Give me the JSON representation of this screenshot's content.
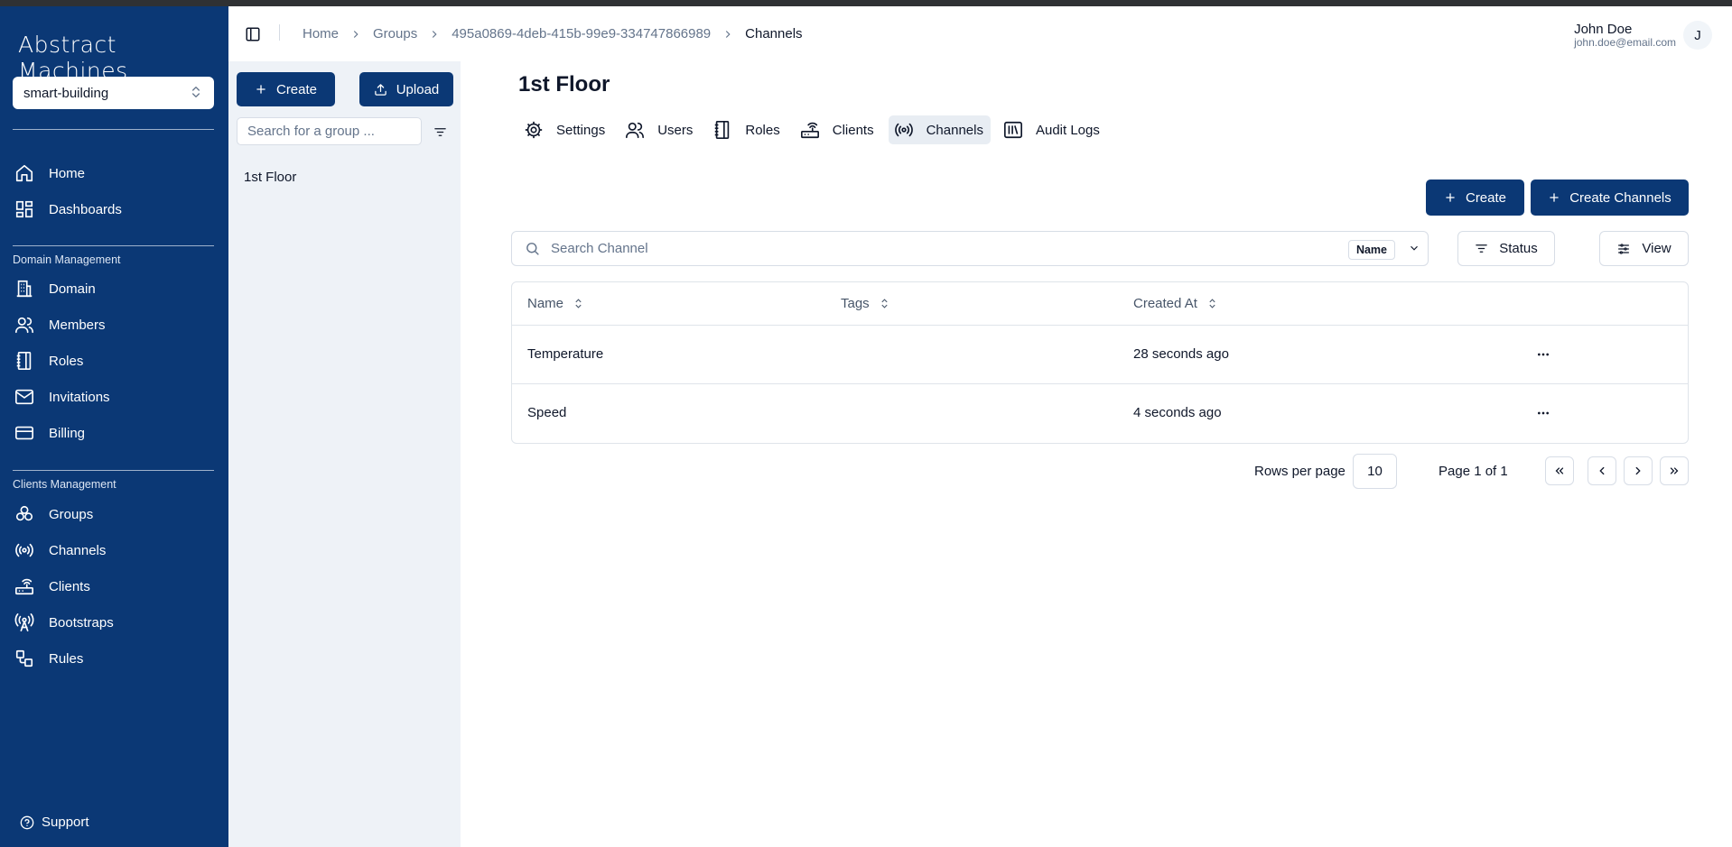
{
  "app": {
    "brand": "Abstract Machines"
  },
  "workspace": {
    "selected": "smart-building"
  },
  "sidebar": {
    "main_items": [
      {
        "label": "Home",
        "icon": "home-icon"
      },
      {
        "label": "Dashboards",
        "icon": "dashboard-icon"
      }
    ],
    "domain_section": "Domain Management",
    "domain_items": [
      {
        "label": "Domain",
        "icon": "building-icon"
      },
      {
        "label": "Members",
        "icon": "users-icon"
      },
      {
        "label": "Roles",
        "icon": "notebook-icon"
      },
      {
        "label": "Invitations",
        "icon": "mail-icon"
      },
      {
        "label": "Billing",
        "icon": "credit-card-icon"
      }
    ],
    "clients_section": "Clients Management",
    "clients_items": [
      {
        "label": "Groups",
        "icon": "groups-icon"
      },
      {
        "label": "Channels",
        "icon": "radio-icon"
      },
      {
        "label": "Clients",
        "icon": "router-icon"
      },
      {
        "label": "Bootstraps",
        "icon": "antenna-icon"
      },
      {
        "label": "Rules",
        "icon": "workflow-icon"
      }
    ],
    "support": "Support"
  },
  "header": {
    "breadcrumb": [
      "Home",
      "Groups",
      "495a0869-4deb-415b-99e9-334747866989",
      "Channels"
    ],
    "user": {
      "name": "John Doe",
      "email": "john.doe@email.com",
      "initial": "J"
    }
  },
  "groups_panel": {
    "create_label": "Create",
    "upload_label": "Upload",
    "search_placeholder": "Search for a group ...",
    "items": [
      "1st Floor"
    ]
  },
  "main": {
    "title": "1st Floor",
    "tabs": [
      {
        "label": "Settings",
        "icon": "gear-icon"
      },
      {
        "label": "Users",
        "icon": "users-icon"
      },
      {
        "label": "Roles",
        "icon": "notebook-icon"
      },
      {
        "label": "Clients",
        "icon": "router-icon"
      },
      {
        "label": "Channels",
        "icon": "radio-icon",
        "active": true
      },
      {
        "label": "Audit Logs",
        "icon": "library-icon"
      }
    ],
    "create_label": "Create",
    "create_channels_label": "Create Channels",
    "search_placeholder": "Search Channel",
    "search_field": "Name",
    "status_label": "Status",
    "view_label": "View",
    "table": {
      "columns": [
        "Name",
        "Tags",
        "Created At"
      ],
      "rows": [
        {
          "name": "Temperature",
          "tags": "",
          "created": "28 seconds ago"
        },
        {
          "name": "Speed",
          "tags": "",
          "created": "4 seconds ago"
        }
      ]
    },
    "pagination": {
      "rows_per_page_label": "Rows per page",
      "rows_per_page": "10",
      "page_info": "Page 1 of 1"
    }
  },
  "colors": {
    "primary": "#0b3875",
    "panel_bg": "#eef2f7",
    "border": "#d7dde6"
  }
}
